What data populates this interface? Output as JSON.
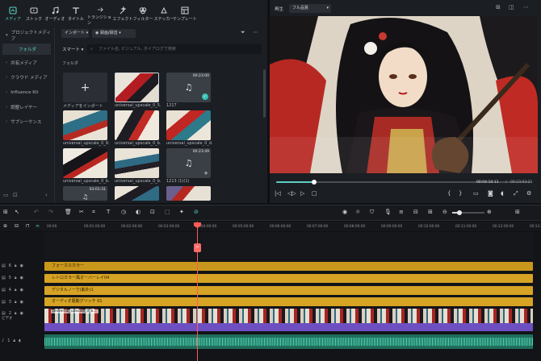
{
  "toolbar": {
    "tabs": [
      {
        "label": "メディア",
        "icon": "media-icon"
      },
      {
        "label": "ストック",
        "icon": "stock-icon"
      },
      {
        "label": "オーディオ",
        "icon": "audio-icon"
      },
      {
        "label": "タイトル",
        "icon": "title-icon"
      },
      {
        "label": "トランジション",
        "icon": "transition-icon"
      },
      {
        "label": "エフェクト",
        "icon": "effect-icon"
      },
      {
        "label": "フィルター",
        "icon": "filter-icon"
      },
      {
        "label": "ステッカー",
        "icon": "sticker-icon"
      },
      {
        "label": "テンプレート",
        "icon": "template-icon"
      }
    ]
  },
  "sidebar": {
    "items": [
      {
        "label": "プロジェクトメディア"
      },
      {
        "label": "フォルダ"
      },
      {
        "label": "共有メディア"
      },
      {
        "label": "クラウド メディア"
      },
      {
        "label": "Influence Kit"
      },
      {
        "label": "調整レイヤー"
      },
      {
        "label": "サブシーケンス"
      }
    ]
  },
  "media": {
    "import_label": "インポート",
    "record_label": "録画/録音",
    "sort_label": "スマート",
    "search_placeholder": "ファイル名, ビジュアル, ダイアログで検索",
    "folder_label": "フォルダ",
    "items": [
      {
        "caption": "メディアをインポート",
        "duration": ""
      },
      {
        "caption": "universal_upscale_0_5...",
        "duration": ""
      },
      {
        "caption": "1217",
        "duration": "00:23:00"
      },
      {
        "caption": "universal_upscale_0_9...",
        "duration": ""
      },
      {
        "caption": "universal_upscale_0_b...",
        "duration": ""
      },
      {
        "caption": "universal_upscale_0_d...",
        "duration": ""
      },
      {
        "caption": "universal_upscale_0_b...",
        "duration": ""
      },
      {
        "caption": "universal_upscale_0_b...",
        "duration": ""
      },
      {
        "caption": "1213 (1)(1)",
        "duration": "00:23:49"
      },
      {
        "caption": "",
        "duration": "03:01:31"
      },
      {
        "caption": "",
        "duration": ""
      },
      {
        "caption": "",
        "duration": ""
      }
    ]
  },
  "preview": {
    "playback_label": "再生",
    "quality_label": "フル品質",
    "current_time": "00:04:10:11",
    "total_time": "00:23:03:21",
    "progress": 0.15
  },
  "timeline": {
    "ruler": [
      "00:00",
      "00:01:00:00",
      "00:02:00:00",
      "00:03:00:00",
      "00:04:00:00",
      "00:05:00:00",
      "00:06:00:00",
      "00:07:00:00",
      "00:08:00:00",
      "00:09:00:00",
      "00:10:00:00",
      "00:11:00:00",
      "00:12:00:00",
      "00:13:00:00"
    ],
    "playhead_label": "00:04:00:00",
    "tracks": [
      {
        "num": "6",
        "clip": "フォーカスカラー"
      },
      {
        "num": "5",
        "clip": "レトロカラー風オーバーレイ04"
      },
      {
        "num": "4",
        "clip": "デジタルノーで(紫外)1"
      },
      {
        "num": "3",
        "clip": "オーディオ駆動グリッチ 01"
      },
      {
        "num": "2",
        "clip": "ビデオ"
      },
      {
        "num": "1",
        "clip": ""
      }
    ],
    "video_clip_label": "universal_upscale_0_b...",
    "audio_label": "Track audio"
  }
}
